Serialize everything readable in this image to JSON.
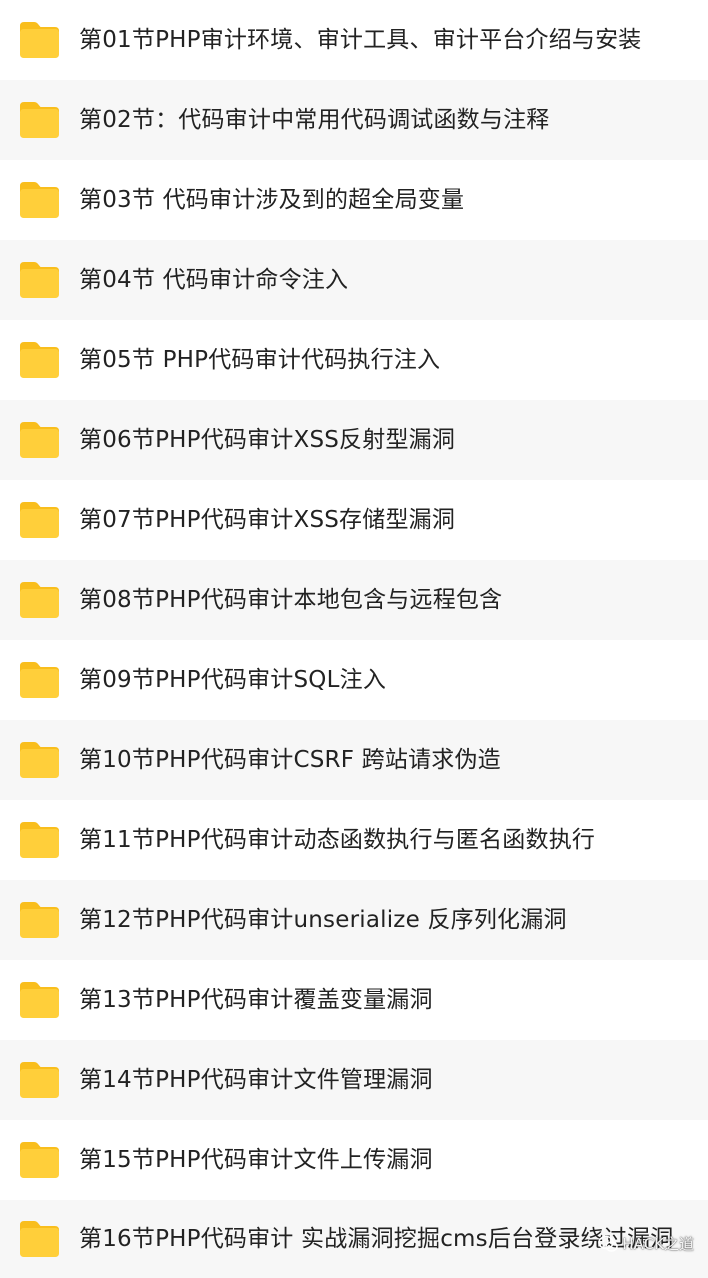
{
  "colors": {
    "folder": "#FFCF3A",
    "folder_tab": "#F9BE1D",
    "text": "#222222",
    "row_alt": "#F7F7F7"
  },
  "items": [
    {
      "label": "第01节PHP审计环境、审计工具、审计平台介绍与安装",
      "icon": "folder-icon"
    },
    {
      "label": "第02节：代码审计中常用代码调试函数与注释",
      "icon": "folder-icon"
    },
    {
      "label": "第03节 代码审计涉及到的超全局变量",
      "icon": "folder-icon"
    },
    {
      "label": "第04节 代码审计命令注入",
      "icon": "folder-icon"
    },
    {
      "label": "第05节 PHP代码审计代码执行注入",
      "icon": "folder-icon"
    },
    {
      "label": "第06节PHP代码审计XSS反射型漏洞",
      "icon": "folder-icon"
    },
    {
      "label": "第07节PHP代码审计XSS存储型漏洞",
      "icon": "folder-icon"
    },
    {
      "label": "第08节PHP代码审计本地包含与远程包含",
      "icon": "folder-icon"
    },
    {
      "label": "第09节PHP代码审计SQL注入",
      "icon": "folder-icon"
    },
    {
      "label": "第10节PHP代码审计CSRF 跨站请求伪造",
      "icon": "folder-icon"
    },
    {
      "label": "第11节PHP代码审计动态函数执行与匿名函数执行",
      "icon": "folder-icon"
    },
    {
      "label": "第12节PHP代码审计unserialize 反序列化漏洞",
      "icon": "folder-icon"
    },
    {
      "label": "第13节PHP代码审计覆盖变量漏洞",
      "icon": "folder-icon"
    },
    {
      "label": "第14节PHP代码审计文件管理漏洞",
      "icon": "folder-icon"
    },
    {
      "label": "第15节PHP代码审计文件上传漏洞",
      "icon": "folder-icon"
    },
    {
      "label": "第16节PHP代码审计 实战漏洞挖掘cms后台登录绕过漏洞",
      "icon": "folder-icon"
    }
  ],
  "watermark": {
    "text": "HACK之道",
    "icon": "wechat-icon"
  }
}
